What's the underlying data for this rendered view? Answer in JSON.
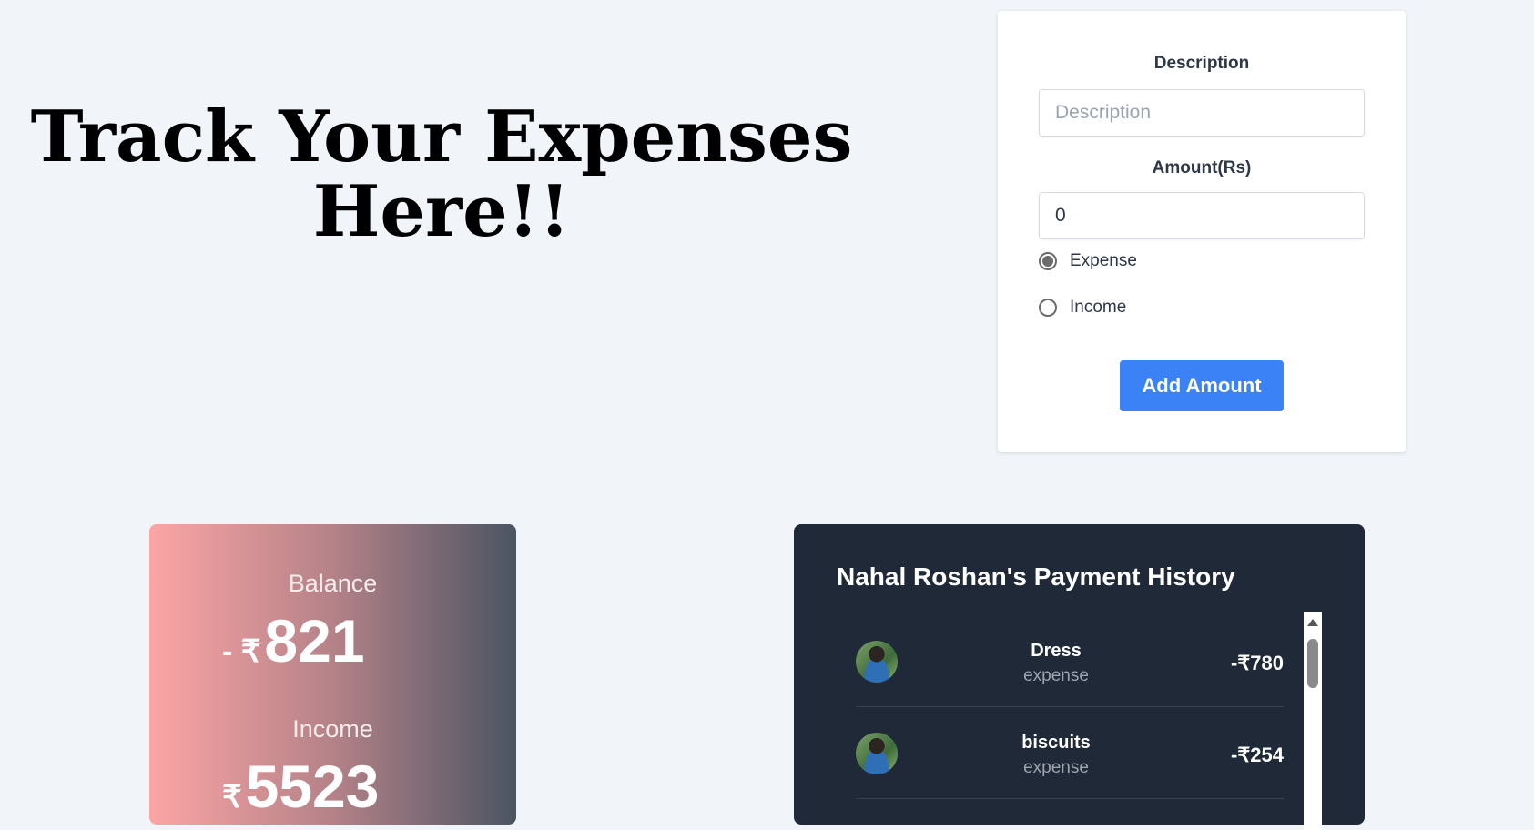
{
  "headline": "Track Your Expenses Here!!",
  "form": {
    "description_label": "Description",
    "description_placeholder": "Description",
    "description_value": "",
    "amount_label": "Amount(Rs)",
    "amount_value": "0",
    "type_options": [
      {
        "label": "Expense",
        "checked": true
      },
      {
        "label": "Income",
        "checked": false
      }
    ],
    "submit_label": "Add Amount"
  },
  "summary": {
    "balance_label": "Balance",
    "balance_prefix": "- ₹",
    "balance_value": "821",
    "income_label": "Income",
    "income_prefix": "₹",
    "income_value": "5523"
  },
  "history": {
    "title": "Nahal Roshan's Payment History",
    "transactions": [
      {
        "name": "Dress",
        "type": "expense",
        "amount": "-₹780"
      },
      {
        "name": "biscuits",
        "type": "expense",
        "amount": "-₹254"
      }
    ]
  },
  "colors": {
    "page_bg": "#f1f4f9",
    "accent_button": "#3b82f6",
    "history_bg": "#1f2937",
    "balance_gradient_start": "#fca5a5",
    "balance_gradient_end": "#4b5563"
  }
}
